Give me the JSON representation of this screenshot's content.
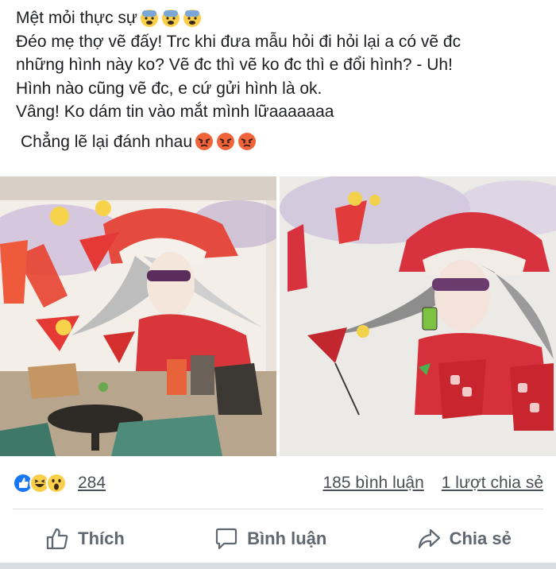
{
  "post": {
    "lines": [
      "Mệt mỏi thực sự",
      "Đéo mẹ thợ vẽ đấy! Trc khi đưa mẫu hỏi đi hỏi lại a có vẽ đc",
      "những hình này ko? Vẽ đc thì vẽ ko đc thì e đổi hình? - Uh!",
      "Hình nào cũng vẽ đc, e cứ gửi hình là ok.",
      "Vâng! Ko dám tin vào mắt mình lữaaaaaaa",
      "Chẳng lẽ lại đánh nhau"
    ],
    "emoji_line1": "fearful-face-emoji",
    "emoji_line6": "angry-face-emoji"
  },
  "photos": {
    "left": "mural-photo-reference",
    "right": "mural-photo-painted"
  },
  "stats": {
    "reaction_icons": [
      "like-reaction-icon",
      "haha-reaction-icon",
      "wow-reaction-icon"
    ],
    "reaction_count": "284",
    "comments": "185 bình luận",
    "shares": "1 lượt chia sẻ"
  },
  "actions": {
    "like": "Thích",
    "comment": "Bình luận",
    "share": "Chia sẻ"
  },
  "colors": {
    "text": "#1c1e21",
    "muted": "#606770",
    "like_blue": "#1877f2",
    "emoji_yellow": "#fbcf4a",
    "angry_orange": "#f0643c"
  }
}
